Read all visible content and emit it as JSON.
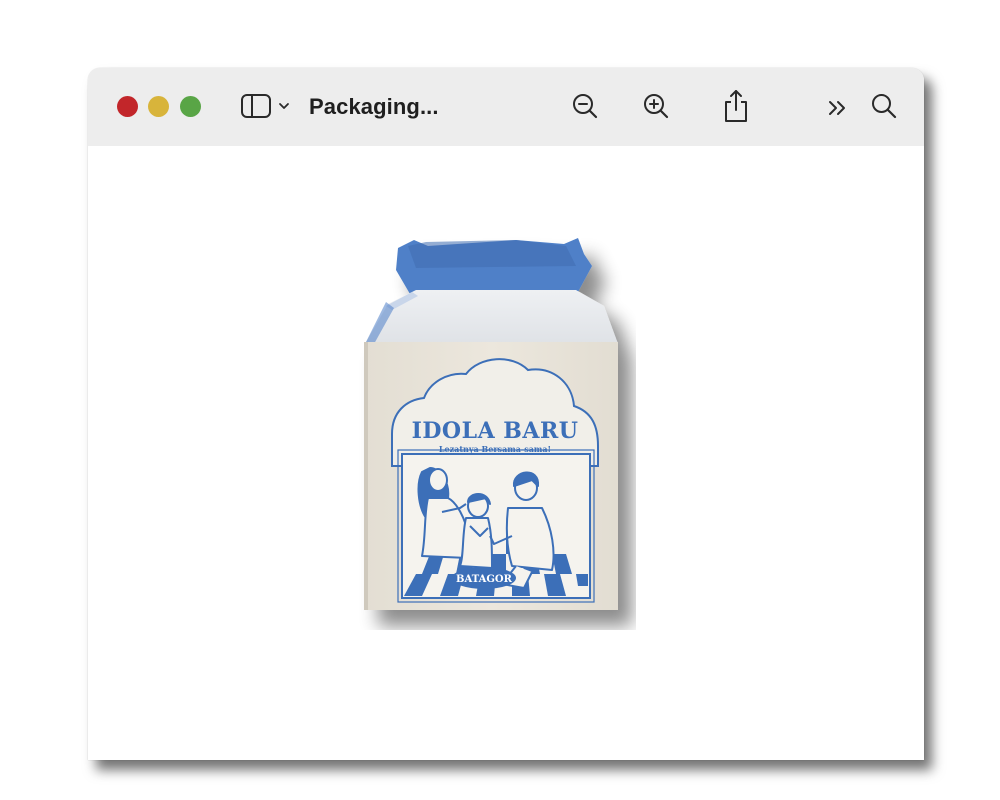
{
  "window": {
    "title": "Packaging...",
    "controls": {
      "close": "close-window-button",
      "minimize": "minimize-window-button",
      "maximize": "maximize-window-button"
    },
    "colors": {
      "close": "#c2262a",
      "minimize": "#d8b43b",
      "maximize": "#59a546",
      "toolbar_bg": "#ededed"
    }
  },
  "toolbar": {
    "icons": [
      "sidebar-icon",
      "chevron-down-icon",
      "zoom-out-icon",
      "zoom-in-icon",
      "share-icon",
      "overflow-chevrons-icon",
      "search-icon"
    ]
  },
  "document": {
    "image": {
      "subject": "gable-top-food-box",
      "box_title": "IDOLA BARU",
      "box_tagline": "Lezatnya Bersama-sama!",
      "box_label": "BATAGOR",
      "colors": {
        "brand_blue": "#3c6fb8",
        "box_cream": "#ebe6db",
        "box_lid": "#e4e7eb",
        "tab_blue": "#4f80c8"
      }
    }
  }
}
